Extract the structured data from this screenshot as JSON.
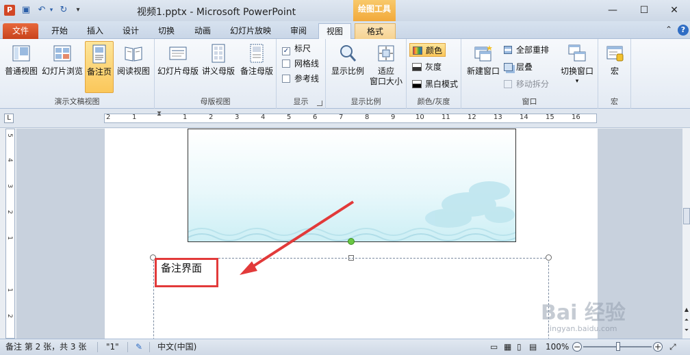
{
  "titlebar": {
    "app_icon": "P",
    "qa_save_icon": "save-icon",
    "qa_undo_icon": "undo-icon",
    "qa_redo_icon": "redo-icon",
    "title": "视频1.pptx - Microsoft PowerPoint",
    "context_group": "绘图工具",
    "min": "—",
    "max": "☐",
    "close": "✕"
  },
  "tabs": {
    "file": "文件",
    "items": [
      "开始",
      "插入",
      "设计",
      "切换",
      "动画",
      "幻灯片放映",
      "审阅",
      "视图",
      "格式"
    ],
    "active": "视图"
  },
  "ribbon": {
    "groups": {
      "presentation_views": {
        "label": "演示文稿视图",
        "buttons": [
          "普通视图",
          "幻灯片浏览",
          "备注页",
          "阅读视图"
        ],
        "selected": "备注页"
      },
      "master_views": {
        "label": "母版视图",
        "buttons": [
          "幻灯片母版",
          "讲义母版",
          "备注母版"
        ]
      },
      "show": {
        "label": "显示",
        "items": [
          {
            "label": "标尺",
            "checked": true
          },
          {
            "label": "网格线",
            "checked": false
          },
          {
            "label": "参考线",
            "checked": false
          }
        ]
      },
      "zoom": {
        "label": "显示比例",
        "buttons": [
          "显示比例",
          "适应",
          "窗口大小"
        ]
      },
      "color": {
        "label": "颜色/灰度",
        "items": [
          "颜色",
          "灰度",
          "黑白模式"
        ],
        "selected": "颜色"
      },
      "window": {
        "label": "窗口",
        "new_window": "新建窗口",
        "arrange_all": "全部重排",
        "cascade": "层叠",
        "move_split": "移动拆分",
        "switch_windows": "切换窗口"
      },
      "macros": {
        "label": "宏",
        "button": "宏"
      }
    }
  },
  "ruler": {
    "h_labels": [
      "2",
      "1",
      "1",
      "2",
      "3",
      "4",
      "5",
      "6",
      "7",
      "8",
      "9",
      "10",
      "11",
      "12",
      "13",
      "14",
      "15",
      "16"
    ],
    "v_labels": [
      "5",
      "4",
      "3",
      "2",
      "1",
      "1",
      "2"
    ]
  },
  "notes": {
    "text": "备注界面"
  },
  "status": {
    "slide_info": "备注 第 2 张，共 3 张",
    "theme": "\"1\"",
    "language": "中文(中国)",
    "zoom": "100%"
  },
  "watermark": {
    "brand": "Bai 经验",
    "url": "jingyan.baidu.com"
  },
  "colors": {
    "accent": "#d24726",
    "selection": "#fbc75a",
    "annotation": "#e23a3a"
  }
}
